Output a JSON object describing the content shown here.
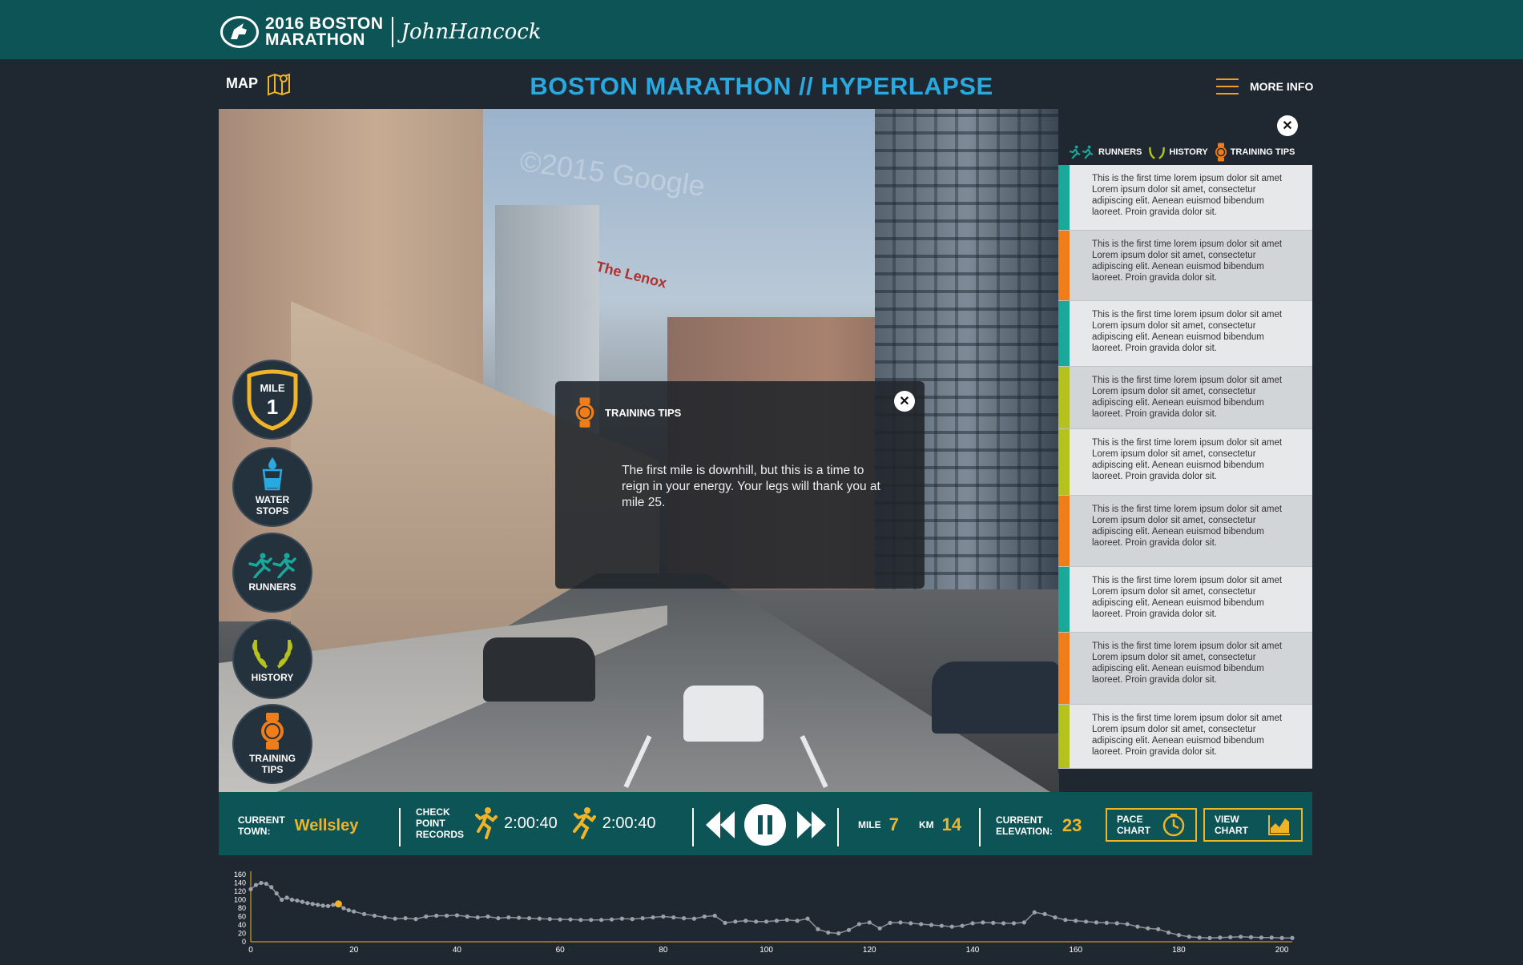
{
  "brand": {
    "logo_line1": "2016 BOSTON",
    "logo_line2": "MARATHON",
    "sponsor": "JohnHancock"
  },
  "header": {
    "map_label": "MAP",
    "title": "BOSTON MARATHON // HYPERLAPSE",
    "more_info_label": "MORE INFO"
  },
  "scene": {
    "watermark": "©2015 Google",
    "sign_text": "The Lenox"
  },
  "rail": {
    "mile_label": "MILE",
    "mile_number": "1",
    "water_label": "WATER\nSTOPS",
    "runners_label": "RUNNERS",
    "history_label": "HISTORY",
    "training_label": "TRAINING\nTIPS"
  },
  "modal": {
    "title": "TRAINING TIPS",
    "body": "The first mile is downhill, but this is a time to reign in your energy. Your legs will thank you at mile 25."
  },
  "panel": {
    "tabs": [
      "RUNNERS",
      "HISTORY",
      "TRAINING TIPS"
    ],
    "items": [
      {
        "text": "This is the first time lorem ipsum dolor sit amet Lorem ipsum dolor sit amet, consectetur adipiscing elit. Aenean euismod bibendum laoreet. Proin gravida dolor sit.",
        "color": "#1aa89a",
        "bg": "#e6e8e9"
      },
      {
        "text": "This is the first time lorem ipsum dolor sit amet Lorem ipsum dolor sit amet, consectetur adipiscing elit. Aenean euismod bibendum laoreet. Proin gravida dolor sit.",
        "color": "#ef7d1a",
        "bg": "#d2d5d7"
      },
      {
        "text": "This is the first time lorem ipsum dolor sit amet Lorem ipsum dolor sit amet, consectetur adipiscing elit. Aenean euismod bibendum laoreet. Proin gravida dolor sit.",
        "color": "#1aa89a",
        "bg": "#e6e8e9"
      },
      {
        "text": "This is the first time lorem ipsum dolor sit amet Lorem ipsum dolor sit amet, consectetur adipiscing elit. Aenean euismod bibendum laoreet. Proin gravida dolor sit.",
        "color": "#b5c21d",
        "bg": "#d2d5d7"
      },
      {
        "text": "This is the first time lorem ipsum dolor sit amet Lorem ipsum dolor sit amet, consectetur adipiscing elit. Aenean euismod bibendum laoreet. Proin gravida dolor sit.",
        "color": "#b5c21d",
        "bg": "#e6e8e9"
      },
      {
        "text": "This is the first time lorem ipsum dolor sit amet Lorem ipsum dolor sit amet, consectetur adipiscing elit. Aenean euismod bibendum laoreet. Proin gravida dolor sit.",
        "color": "#ef7d1a",
        "bg": "#d2d5d7"
      },
      {
        "text": "This is the first time lorem ipsum dolor sit amet Lorem ipsum dolor sit amet, consectetur adipiscing elit. Aenean euismod bibendum laoreet. Proin gravida dolor sit.",
        "color": "#1aa89a",
        "bg": "#e6e8e9"
      },
      {
        "text": "This is the first time lorem ipsum dolor sit amet Lorem ipsum dolor sit amet, consectetur adipiscing elit. Aenean euismod bibendum laoreet. Proin gravida dolor sit.",
        "color": "#ef7d1a",
        "bg": "#d2d5d7"
      },
      {
        "text": "This is the first time lorem ipsum dolor sit amet Lorem ipsum dolor sit amet, consectetur adipiscing elit. Aenean euismod bibendum laoreet. Proin gravida dolor sit.",
        "color": "#b5c21d",
        "bg": "#e6e8e9"
      }
    ]
  },
  "controls": {
    "town_label": "CURRENT\nTOWN:",
    "town_value": "Wellsley",
    "checkpoint_label": "CHECK\nPOINT\nRECORDS",
    "record_1": "2:00:40",
    "record_2": "2:00:40",
    "mile_label": "MILE",
    "mile_value": "7",
    "km_label": "KM",
    "km_value": "14",
    "elevation_label": "CURRENT\nELEVATION:",
    "elevation_value": "23",
    "pace_chart_label": "PACE\nCHART",
    "view_chart_label": "VIEW\nCHART"
  },
  "colors": {
    "teal": "#0d5457",
    "accent": "#f0b429",
    "title_blue": "#29a9e0",
    "orange": "#ef7d1a"
  },
  "chart_data": {
    "type": "line",
    "title": "",
    "xlabel": "",
    "ylabel": "",
    "xlim": [
      0,
      202
    ],
    "ylim": [
      0,
      160
    ],
    "x_ticks": [
      0,
      20,
      40,
      60,
      80,
      100,
      120,
      140,
      160,
      180,
      200
    ],
    "y_ticks": [
      0,
      20,
      40,
      60,
      80,
      100,
      120,
      140,
      160
    ],
    "current_x": 17,
    "series": [
      {
        "x": [
          0,
          1,
          2,
          3,
          4,
          5,
          6,
          7,
          8,
          9,
          10,
          11,
          12,
          13,
          14,
          15,
          16,
          17,
          18,
          19,
          20,
          22,
          24,
          26,
          28,
          30,
          32,
          34,
          36,
          38,
          40,
          42,
          44,
          46,
          48,
          50,
          52,
          54,
          56,
          58,
          60,
          62,
          64,
          66,
          68,
          70,
          72,
          74,
          76,
          78,
          80,
          82,
          84,
          86,
          88,
          90,
          92,
          94,
          96,
          98,
          100,
          102,
          104,
          106,
          108,
          110,
          112,
          114,
          116,
          118,
          120,
          122,
          124,
          126,
          128,
          130,
          132,
          134,
          136,
          138,
          140,
          142,
          144,
          146,
          148,
          150,
          152,
          154,
          156,
          158,
          160,
          162,
          164,
          166,
          168,
          170,
          172,
          174,
          176,
          178,
          180,
          182,
          184,
          186,
          188,
          190,
          192,
          194,
          196,
          198,
          200,
          202
        ],
        "y": [
          125,
          135,
          140,
          138,
          130,
          115,
          100,
          105,
          100,
          98,
          95,
          92,
          90,
          88,
          86,
          85,
          88,
          90,
          80,
          75,
          72,
          66,
          62,
          58,
          55,
          56,
          54,
          60,
          62,
          62,
          63,
          60,
          58,
          60,
          56,
          58,
          57,
          56,
          55,
          54,
          53,
          53,
          52,
          52,
          52,
          53,
          55,
          54,
          56,
          58,
          60,
          58,
          56,
          55,
          60,
          62,
          45,
          48,
          50,
          48,
          48,
          50,
          52,
          50,
          55,
          30,
          22,
          20,
          28,
          42,
          46,
          32,
          45,
          46,
          44,
          42,
          40,
          38,
          36,
          38,
          44,
          46,
          45,
          44,
          44,
          46,
          70,
          66,
          58,
          52,
          50,
          48,
          46,
          45,
          44,
          42,
          36,
          32,
          30,
          22,
          16,
          12,
          10,
          9,
          10,
          11,
          12,
          11,
          10,
          10,
          9,
          9
        ]
      }
    ]
  }
}
